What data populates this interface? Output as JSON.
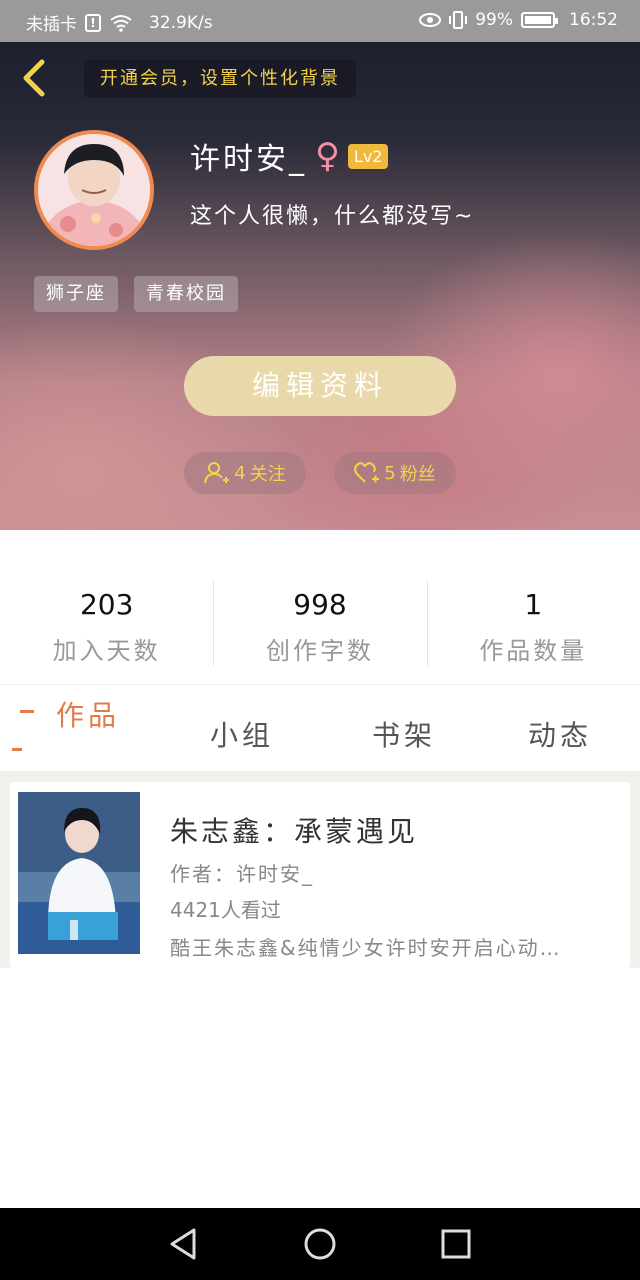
{
  "status_bar": {
    "carrier": "未插卡",
    "speed": "32.9K/s",
    "battery_pct": "99%",
    "battery_level": 0.99,
    "time": "16:52"
  },
  "header": {
    "vip_banner": "开通会员，设置个性化背景",
    "nickname": "许时安_",
    "gender_symbol": "♀",
    "level": "Lv2",
    "signature": "这个人很懒，什么都没写~",
    "tags": [
      "狮子座",
      "青春校园"
    ],
    "edit_button": "编辑资料",
    "follow": {
      "count": "4",
      "label": "关注"
    },
    "fans": {
      "count": "5",
      "label": "粉丝"
    }
  },
  "stats": [
    {
      "value": "203",
      "label": "加入天数"
    },
    {
      "value": "998",
      "label": "创作字数"
    },
    {
      "value": "1",
      "label": "作品数量"
    }
  ],
  "tabs": [
    {
      "label": "作品",
      "active": true
    },
    {
      "label": "小组",
      "active": false
    },
    {
      "label": "书架",
      "active": false
    },
    {
      "label": "动态",
      "active": false
    }
  ],
  "works": [
    {
      "title": "朱志鑫：承蒙遇见",
      "author": "作者：许时安_",
      "views": "4421人看过",
      "description": "酷王朱志鑫&纯情少女许时安开启心动…"
    }
  ],
  "colors": {
    "accent": "#e07c4a",
    "vip_yellow": "#f2d34e",
    "edit_button_bg": "#e9d9aa",
    "level_badge": "#f0b93a"
  }
}
